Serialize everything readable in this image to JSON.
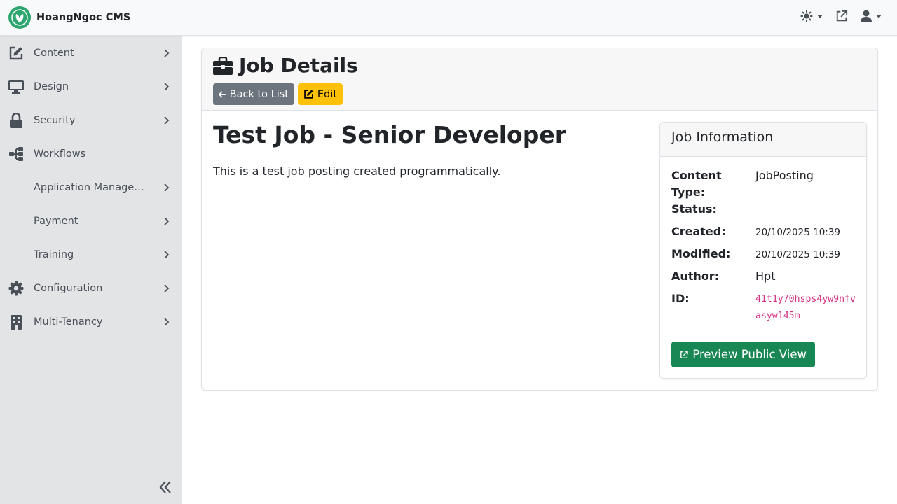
{
  "app": {
    "name": "HoangNgoc CMS"
  },
  "sidebar": {
    "items": [
      {
        "label": "Content",
        "icon": "edit-icon"
      },
      {
        "label": "Design",
        "icon": "monitor-icon"
      },
      {
        "label": "Security",
        "icon": "lock-icon"
      },
      {
        "label": "Workflows",
        "icon": "workflow-icon"
      },
      {
        "label": "Application Management",
        "icon": ""
      },
      {
        "label": "Payment",
        "icon": ""
      },
      {
        "label": "Training",
        "icon": ""
      },
      {
        "label": "Configuration",
        "icon": "gear-icon"
      },
      {
        "label": "Multi-Tenancy",
        "icon": "building-icon"
      }
    ]
  },
  "page": {
    "title": "Job Details",
    "back_label": "Back to List",
    "edit_label": "Edit"
  },
  "job": {
    "title": "Test Job - Senior Developer",
    "description": "This is a test job posting created programmatically."
  },
  "info": {
    "header": "Job Information",
    "content_type_label": "Content Type:",
    "content_type_value": "JobPosting",
    "status_label": "Status:",
    "status_value": "",
    "created_label": "Created:",
    "created_value": "20/10/2025 10:39",
    "modified_label": "Modified:",
    "modified_value": "20/10/2025 10:39",
    "author_label": "Author:",
    "author_value": "Hpt",
    "id_label": "ID:",
    "id_value": "41t1y70hsps4yw9nfvasyw145m",
    "preview_label": "Preview Public View"
  },
  "colors": {
    "primary_green": "#198754",
    "brand_green": "#2ea66f",
    "warning": "#ffc107",
    "secondary": "#6c757d",
    "code_pink": "#d63384"
  }
}
